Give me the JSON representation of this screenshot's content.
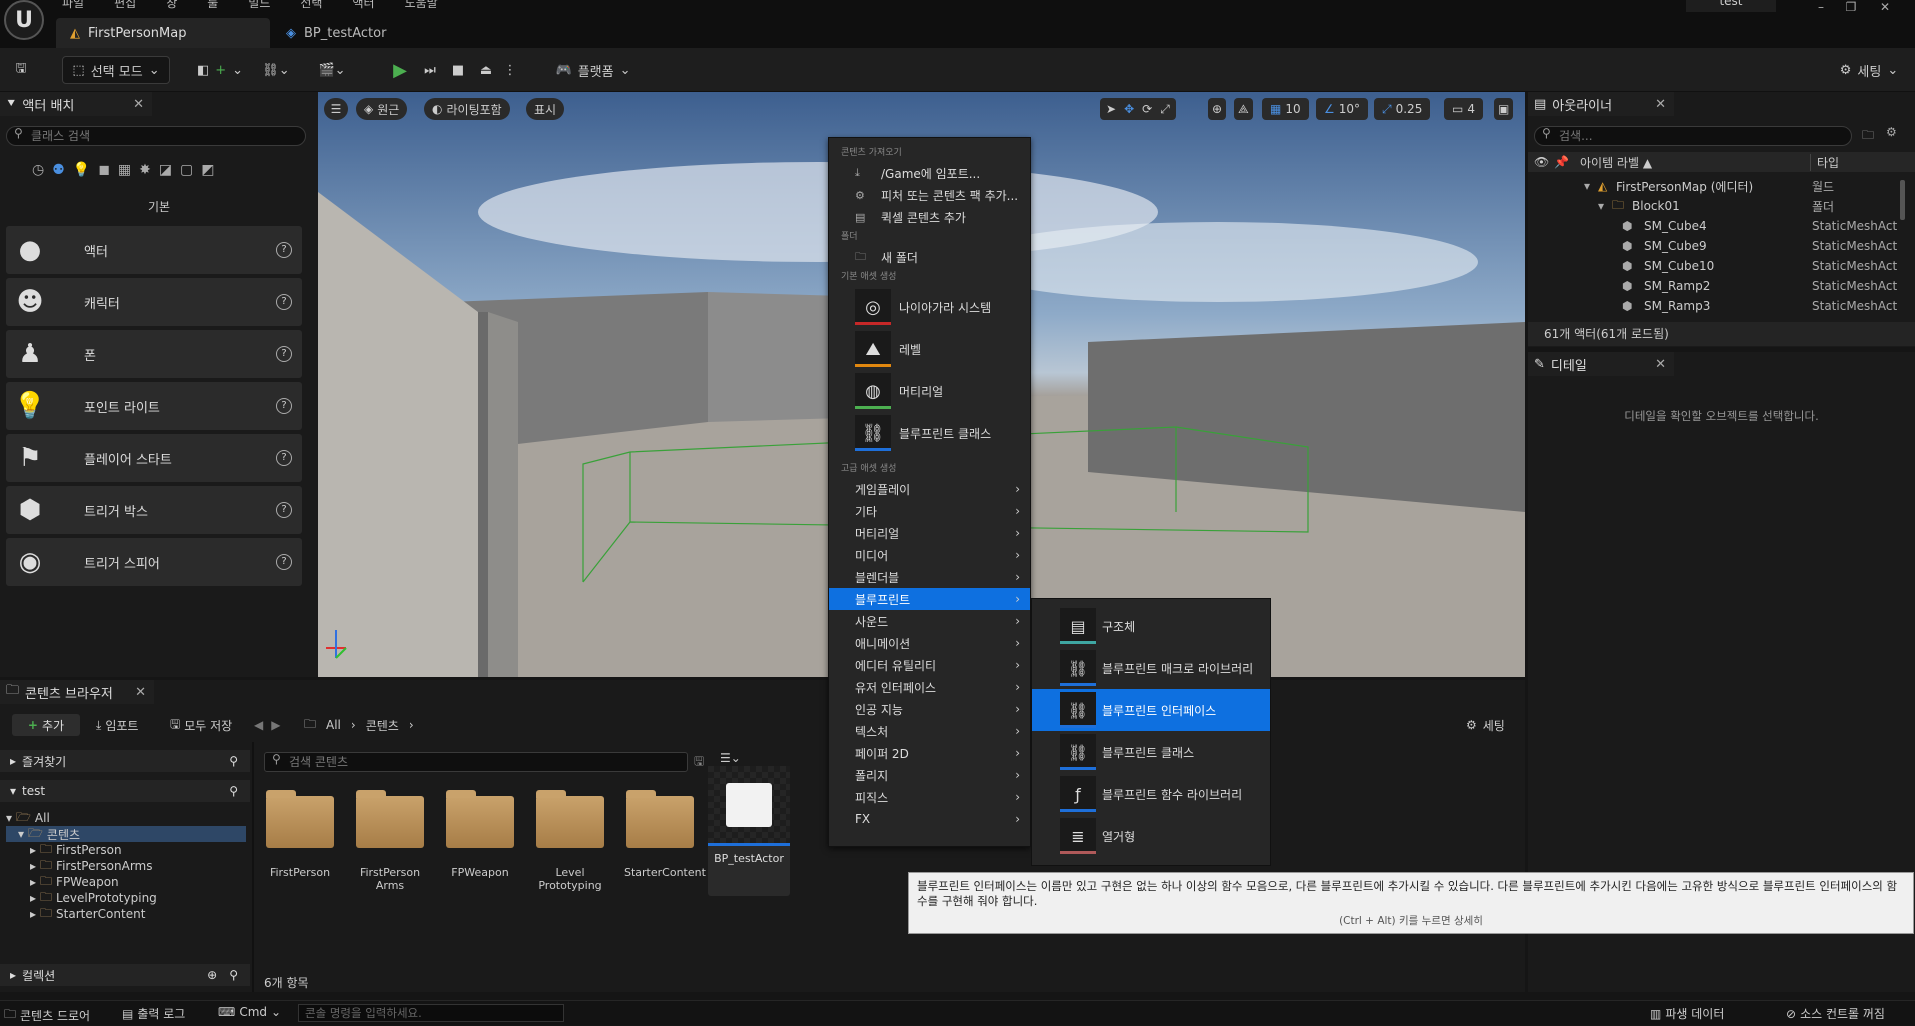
{
  "app": {
    "logo": "U",
    "project_name": "test"
  },
  "menu": [
    "파일",
    "편집",
    "창",
    "툴",
    "빌드",
    "선택",
    "액터",
    "도움말"
  ],
  "tabs": [
    {
      "label": "FirstPersonMap",
      "icon": "level-icon"
    },
    {
      "label": "BP_testActor",
      "icon": "blueprint-icon"
    }
  ],
  "window_controls": [
    "–",
    "❐",
    "✕"
  ],
  "toolbar": {
    "mode_label": "선택 모드",
    "platform_label": "플랫폼",
    "settings_label": "세팅"
  },
  "place_actors": {
    "title": "액터 배치",
    "search_placeholder": "클래스 검색",
    "category": "기본",
    "items": [
      "액터",
      "캐릭터",
      "폰",
      "포인트 라이트",
      "플레이어 스타트",
      "트리거 박스",
      "트리거 스피어"
    ]
  },
  "viewport": {
    "btn_perspective": "원근",
    "btn_lit": "라이팅포함",
    "btn_show": "표시",
    "grid_snap": "10",
    "rot_snap": "10°",
    "scale_snap": "0.25",
    "camera_speed": "4"
  },
  "outliner": {
    "title": "아웃라이너",
    "search_placeholder": "검색...",
    "col_label": "아이템 라벨 ▲",
    "col_type": "타입",
    "rows": [
      {
        "label": "FirstPersonMap (에디터)",
        "type": "월드",
        "indent": 0
      },
      {
        "label": "Block01",
        "type": "폴더",
        "indent": 1
      },
      {
        "label": "SM_Cube4",
        "type": "StaticMeshAct",
        "indent": 2
      },
      {
        "label": "SM_Cube9",
        "type": "StaticMeshAct",
        "indent": 2
      },
      {
        "label": "SM_Cube10",
        "type": "StaticMeshAct",
        "indent": 2
      },
      {
        "label": "SM_Ramp2",
        "type": "StaticMeshAct",
        "indent": 2
      },
      {
        "label": "SM_Ramp3",
        "type": "StaticMeshAct",
        "indent": 2
      }
    ],
    "footer": "61개 액터(61개 로드됨)"
  },
  "details": {
    "title": "디테일",
    "empty_text": "디테일을 확인할 오브젝트를 선택합니다."
  },
  "content_browser": {
    "title": "콘텐츠 브라우저",
    "add_label": "추가",
    "import_label": "임포트",
    "save_all_label": "모두 저장",
    "path": [
      "All",
      "콘텐츠"
    ],
    "settings_label": "세팅",
    "favorites_label": "즐겨찾기",
    "project_label": "test",
    "tree": [
      "All",
      "콘텐츠",
      "FirstPerson",
      "FirstPersonArms",
      "FPWeapon",
      "LevelPrototyping",
      "StarterContent"
    ],
    "collections_label": "컬렉션",
    "search_placeholder": "검색 콘텐츠",
    "assets": [
      {
        "name": "FirstPerson",
        "kind": "folder"
      },
      {
        "name": "FirstPerson Arms",
        "kind": "folder"
      },
      {
        "name": "FPWeapon",
        "kind": "folder"
      },
      {
        "name": "Level Prototyping",
        "kind": "folder"
      },
      {
        "name": "StarterContent",
        "kind": "folder"
      },
      {
        "name": "BP_testActor",
        "kind": "blueprint"
      }
    ],
    "count_label": "6개 항목"
  },
  "status": {
    "content_drawer": "콘텐츠 드로어",
    "output_log": "출력 로그",
    "cmd": "Cmd",
    "console_placeholder": "콘솔 명령을 입력하세요.",
    "derived_data": "파생 데이터",
    "source_control": "소스 컨트롤 꺼짐"
  },
  "context_menu": {
    "section_import": "콘텐츠 가져오기",
    "import_items": [
      "/Game에 임포트...",
      "피처 또는 콘텐츠 팩 추가...",
      "퀵셀 콘텐츠 추가"
    ],
    "section_folder": "폴더",
    "new_folder": "새 폴더",
    "section_basic": "기본 애셋 생성",
    "basic_items": [
      {
        "label": "나이아가라 시스템",
        "color": "#c62828"
      },
      {
        "label": "레벨",
        "color": "#e0870f"
      },
      {
        "label": "머티리얼",
        "color": "#4caf50"
      },
      {
        "label": "블루프린트 클래스",
        "color": "#1e6fd9"
      }
    ],
    "section_advanced": "고급 애셋 생성",
    "advanced_items": [
      "게임플레이",
      "기타",
      "머티리얼",
      "미디어",
      "블렌더블",
      "블루프린트",
      "사운드",
      "애니메이션",
      "에디터 유틸리티",
      "유저 인터페이스",
      "인공 지능",
      "텍스처",
      "페이퍼 2D",
      "폴리지",
      "피직스",
      "FX"
    ],
    "selected_index": 5
  },
  "submenu": {
    "items": [
      {
        "label": "구조체",
        "color": "#3fa7a3"
      },
      {
        "label": "블루프린트 매크로 라이브러리",
        "color": "#1e6fd9"
      },
      {
        "label": "블루프린트 인터페이스",
        "color": "#1e6fd9"
      },
      {
        "label": "블루프린트 클래스",
        "color": "#1e6fd9"
      },
      {
        "label": "블루프린트 함수 라이브러리",
        "color": "#1e6fd9"
      },
      {
        "label": "열거형",
        "color": "#b05a5a"
      }
    ],
    "selected_index": 2
  },
  "tooltip": {
    "text": "블루프린트 인터페이스는 이름만 있고 구현은 없는 하나 이상의 함수 모음으로, 다른 블루프린트에 추가시킬 수 있습니다. 다른 블루프린트에 추가시킨 다음에는 고유한 방식으로 블루프린트 인터페이스의 함수를 구현해 줘야 합니다.",
    "hint": "(Ctrl + Alt) 키를 누르면 상세히"
  }
}
